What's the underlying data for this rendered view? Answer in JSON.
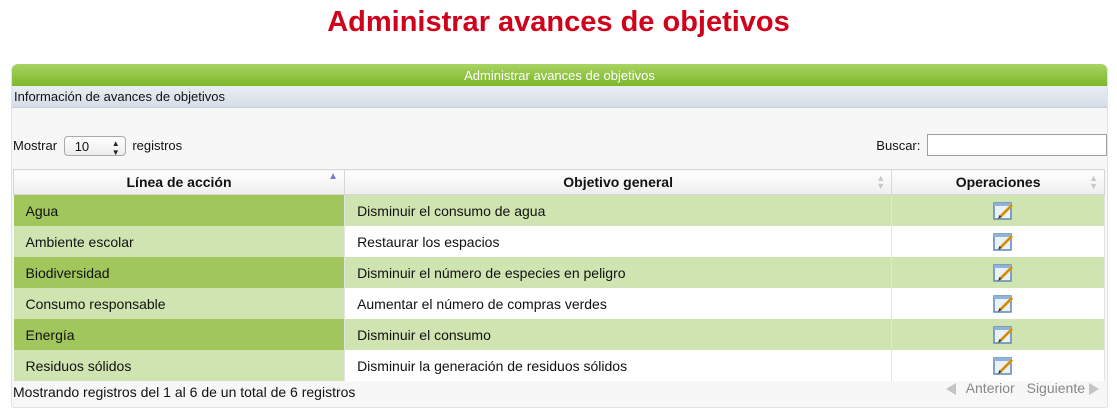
{
  "page_title": "Administrar avances de objetivos",
  "panel": {
    "header": "Administrar avances de objetivos",
    "section": "Información de avances de objetivos"
  },
  "controls": {
    "show_label": "Mostrar",
    "page_size": "10",
    "records_label": "registros",
    "search_label": "Buscar:",
    "search_value": ""
  },
  "table": {
    "columns": [
      "Línea de acción",
      "Objetivo general",
      "Operaciones"
    ],
    "rows": [
      {
        "linea": "Agua",
        "objetivo": "Disminuir el consumo de agua"
      },
      {
        "linea": "Ambiente escolar",
        "objetivo": "Restaurar los espacios"
      },
      {
        "linea": "Biodiversidad",
        "objetivo": "Disminuir el número de especies en peligro"
      },
      {
        "linea": "Consumo responsable",
        "objetivo": "Aumentar el número de compras verdes"
      },
      {
        "linea": "Energía",
        "objetivo": "Disminuir el consumo"
      },
      {
        "linea": "Residuos sólidos",
        "objetivo": "Disminuir la generación de residuos sólidos"
      }
    ],
    "operation_icon": "edit-icon"
  },
  "footer": {
    "info": "Mostrando registros del 1 al 6 de un total de 6 registros",
    "prev": "Anterior",
    "next": "Siguiente"
  },
  "colors": {
    "title": "#d0021b",
    "header_green": "#8cc43c",
    "row_dark": "#a1c65c",
    "row_light": "#d0e4b1"
  }
}
